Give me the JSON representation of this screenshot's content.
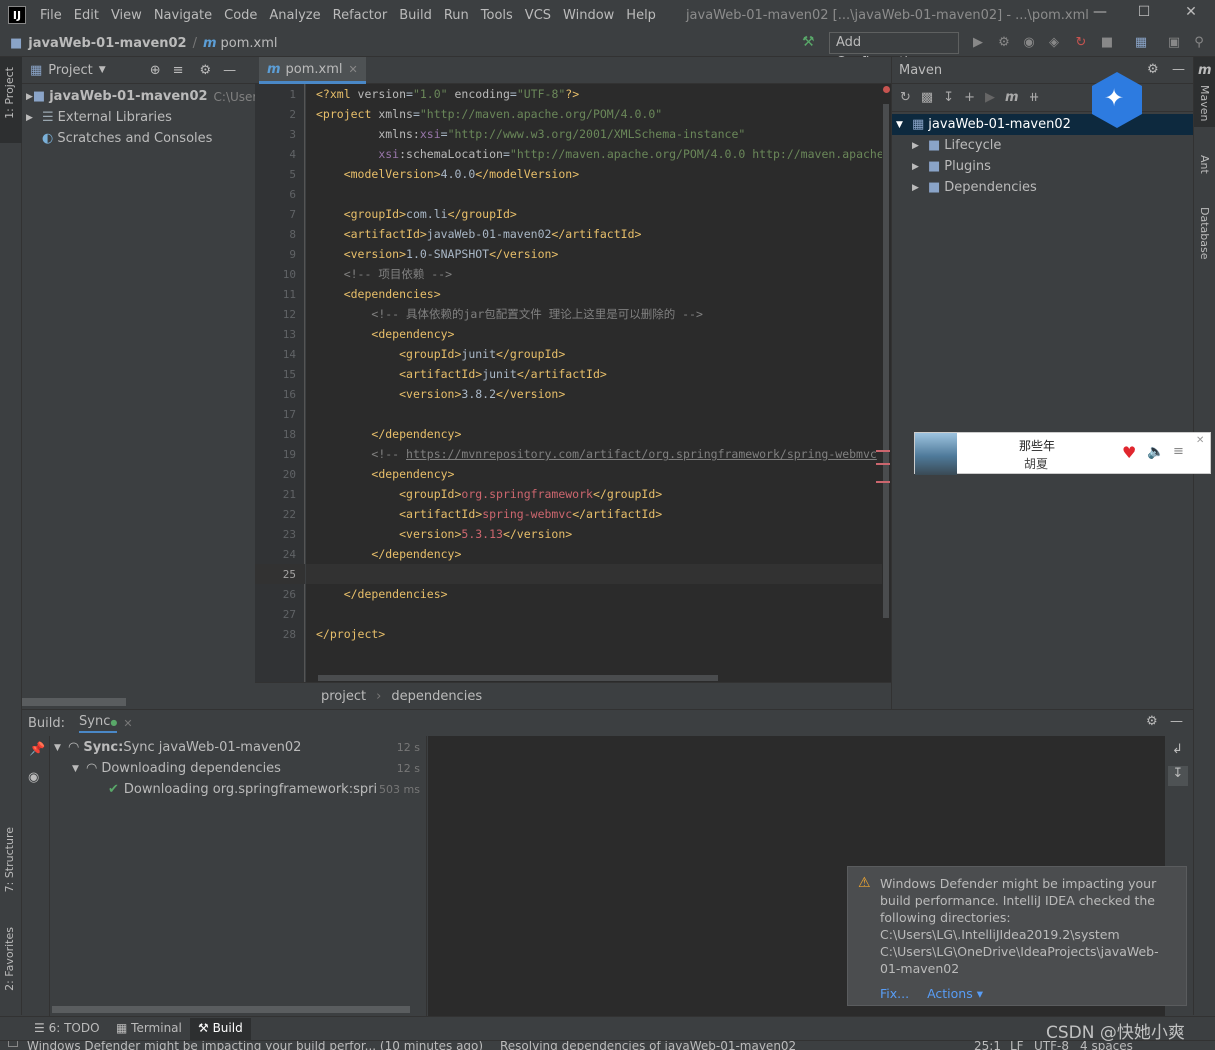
{
  "titlebar": {
    "logo": "IJ",
    "menus": [
      "File",
      "Edit",
      "View",
      "Navigate",
      "Code",
      "Analyze",
      "Refactor",
      "Build",
      "Run",
      "Tools",
      "VCS",
      "Window",
      "Help"
    ],
    "window_title": "javaWeb-01-maven02 [...\\javaWeb-01-maven02] - ...\\pom.xml"
  },
  "navbar": {
    "project": "javaWeb-01-maven02",
    "file": "pom.xml",
    "add_config": "Add Configuration..."
  },
  "left_strip": {
    "project_tab": "1: Project",
    "structure_tab": "7: Structure",
    "favorites_tab": "2: Favorites"
  },
  "project_panel": {
    "title": "Project",
    "items": [
      {
        "label": "javaWeb-01-maven02",
        "hint": "C:\\Users\\"
      },
      {
        "label": "External Libraries"
      },
      {
        "label": "Scratches and Consoles"
      }
    ]
  },
  "editor": {
    "tab": "pom.xml",
    "breadcrumb": [
      "project",
      "dependencies"
    ],
    "line_numbers": [
      "1",
      "2",
      "3",
      "4",
      "5",
      "6",
      "7",
      "8",
      "9",
      "10",
      "11",
      "12",
      "13",
      "14",
      "15",
      "16",
      "17",
      "18",
      "19",
      "20",
      "21",
      "22",
      "23",
      "24",
      "25",
      "26",
      "27",
      "28"
    ]
  },
  "maven": {
    "title": "Maven",
    "root": "javaWeb-01-maven02",
    "children": [
      "Lifecycle",
      "Plugins",
      "Dependencies"
    ]
  },
  "right_strip": {
    "maven_tab": "Maven",
    "ant_tab": "Ant",
    "database_tab": "Database"
  },
  "build": {
    "label": "Build:",
    "tab": "Sync",
    "rows": [
      {
        "bold": "Sync:",
        "text": " Sync javaWeb-01-maven02",
        "time": "12 s"
      },
      {
        "bold": "",
        "text": "Downloading dependencies",
        "time": "12 s"
      },
      {
        "bold": "",
        "text": "Downloading org.springframework:spring-w",
        "time": "503 ms"
      }
    ]
  },
  "notification": {
    "lines": [
      "Windows Defender might be impacting your",
      "build performance. IntelliJ IDEA checked the",
      "following directories:",
      "C:\\Users\\LG\\.IntelliJIdea2019.2\\system",
      "C:\\Users\\LG\\OneDrive\\IdeaProjects\\javaWeb-",
      "01-maven02"
    ],
    "fix": "Fix...",
    "actions": "Actions"
  },
  "music": {
    "song": "那些年",
    "artist": "胡夏"
  },
  "bottom_tabs": [
    "6: TODO",
    "Terminal",
    "Build"
  ],
  "status": {
    "message": "Windows Defender might be impacting your build perfor... (10 minutes ago)",
    "progress": "Resolving dependencies of javaWeb-01-maven02",
    "position": "25:1",
    "line_sep": "LF",
    "encoding": "UTF-8",
    "indent": "4 spaces"
  },
  "watermark": "CSDN @快她小爽",
  "colors": {
    "accent": "#4a88c7",
    "tag": "#e8bf6a",
    "attr_value": "#6a8759",
    "comment": "#808080",
    "error": "#cc666e"
  }
}
